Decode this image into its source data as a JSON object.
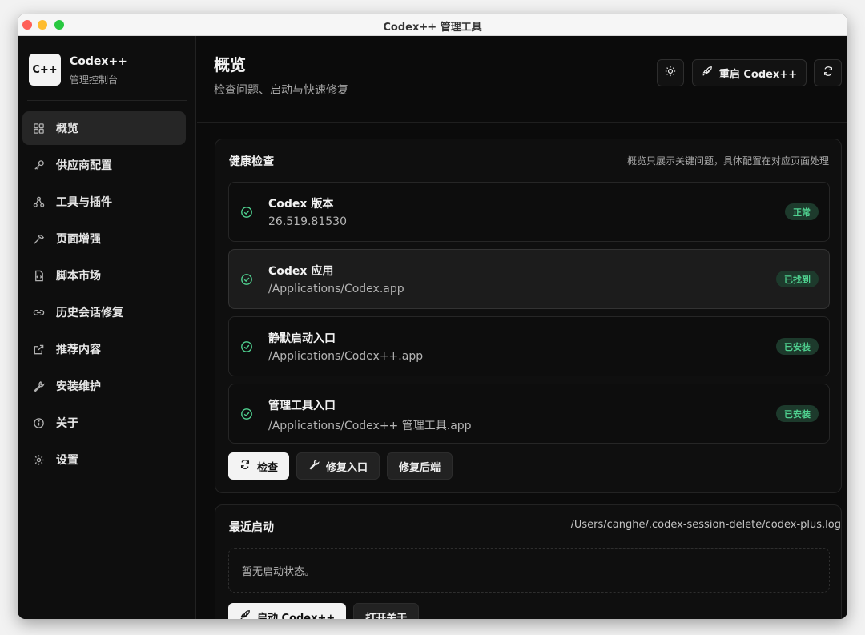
{
  "window": {
    "title": "Codex++ 管理工具"
  },
  "brand": {
    "logo_text": "C++",
    "name": "Codex++",
    "subtitle": "管理控制台"
  },
  "sidebar": {
    "items": [
      {
        "label": "概览",
        "icon": "grid-icon",
        "active": true
      },
      {
        "label": "供应商配置",
        "icon": "key-icon"
      },
      {
        "label": "工具与插件",
        "icon": "nodes-icon"
      },
      {
        "label": "页面增强",
        "icon": "hammer-icon"
      },
      {
        "label": "脚本市场",
        "icon": "script-icon"
      },
      {
        "label": "历史会话修复",
        "icon": "link-icon"
      },
      {
        "label": "推荐内容",
        "icon": "external-link-icon"
      },
      {
        "label": "安装维护",
        "icon": "wrench-icon"
      },
      {
        "label": "关于",
        "icon": "info-icon"
      },
      {
        "label": "设置",
        "icon": "gear-icon"
      }
    ]
  },
  "header": {
    "title": "概览",
    "subtitle": "检查问题、启动与快速修复",
    "restart_label": "重启 Codex++"
  },
  "health": {
    "title": "健康检查",
    "note": "概览只展示关键问题，具体配置在对应页面处理",
    "items": [
      {
        "title": "Codex 版本",
        "value": "26.519.81530",
        "badge": "正常"
      },
      {
        "title": "Codex 应用",
        "value": "/Applications/Codex.app",
        "badge": "已找到"
      },
      {
        "title": "静默启动入口",
        "value": "/Applications/Codex++.app",
        "badge": "已安装"
      },
      {
        "title": "管理工具入口",
        "value": "/Applications/Codex++ 管理工具.app",
        "badge": "已安装"
      }
    ],
    "actions": {
      "check": "检查",
      "repair_entry": "修复入口",
      "repair_backend": "修复后端"
    }
  },
  "launch": {
    "title": "最近启动",
    "log_path": "/Users/canghe/.codex-session-delete/codex-plus.log",
    "empty": "暂无启动状态。",
    "actions": {
      "launch": "启动 Codex++",
      "open_about": "打开关于"
    }
  },
  "colors": {
    "accent_green": "#4fd08f",
    "badge_bg": "#1d3a2c"
  }
}
